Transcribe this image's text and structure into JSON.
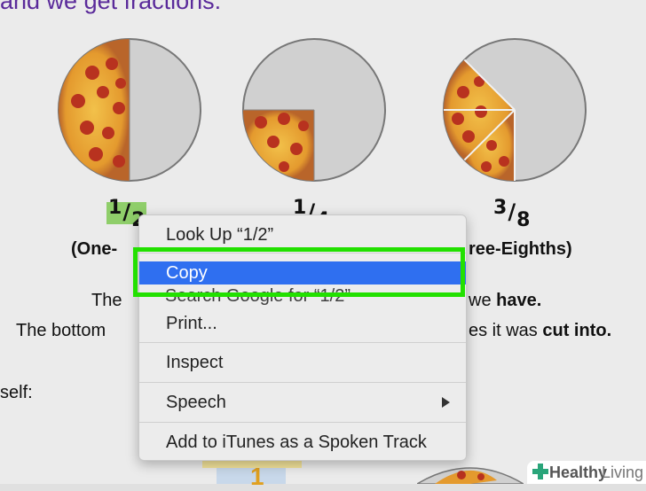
{
  "heading": "and we get fractions:",
  "fractions": [
    {
      "num": "1",
      "den": "2",
      "caption": "(One-"
    },
    {
      "num": "1",
      "den": "4",
      "caption": ""
    },
    {
      "num": "3",
      "den": "8",
      "caption": "ree-Eighths)"
    }
  ],
  "body": {
    "line1_start": "The",
    "line1_end": "we",
    "line1_bold": "have.",
    "line2_start": "The bottom",
    "line2_mid": "es it was",
    "line2_bold": "cut into.",
    "line3": "self:"
  },
  "context_menu": {
    "items": [
      {
        "label": "Look Up “1/2”"
      },
      {
        "label": "Copy"
      },
      {
        "label": "Search Google for “1/2”"
      },
      {
        "label": "Print..."
      },
      {
        "label": "Inspect"
      },
      {
        "label": "Speech"
      },
      {
        "label": "Add to iTunes as a Spoken Track"
      }
    ],
    "selected": "Copy",
    "accent": "#2f6ff0"
  },
  "highlight_color": "#22e000",
  "watermark": {
    "brand_bold": "Healthy",
    "brand_light": "Living"
  }
}
